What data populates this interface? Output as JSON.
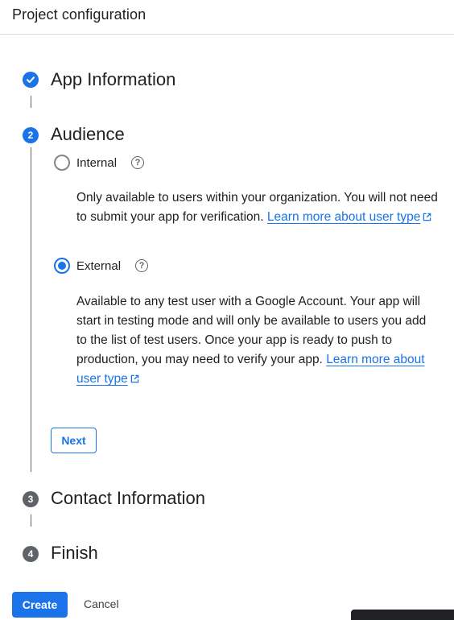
{
  "header": {
    "title": "Project configuration"
  },
  "steps": [
    {
      "number": "",
      "title": "App Information",
      "state": "done"
    },
    {
      "number": "2",
      "title": "Audience",
      "state": "active"
    },
    {
      "number": "3",
      "title": "Contact Information",
      "state": "pending"
    },
    {
      "number": "4",
      "title": "Finish",
      "state": "pending"
    }
  ],
  "audience": {
    "options": [
      {
        "label": "Internal",
        "selected": false,
        "description": "Only available to users within your organization. You will not need to submit your app for verification. ",
        "link_text": "Learn more about user type"
      },
      {
        "label": "External",
        "selected": true,
        "description": "Available to any test user with a Google Account. Your app will start in testing mode and will only be available to users you add to the list of test users. Once your app is ready to push to production, you may need to verify your app. ",
        "link_text": "Learn more about user type"
      }
    ],
    "next_label": "Next"
  },
  "footer": {
    "create_label": "Create",
    "cancel_label": "Cancel"
  },
  "colors": {
    "primary": "#1a73e8",
    "pending_step": "#5f6368",
    "text": "#202124"
  }
}
